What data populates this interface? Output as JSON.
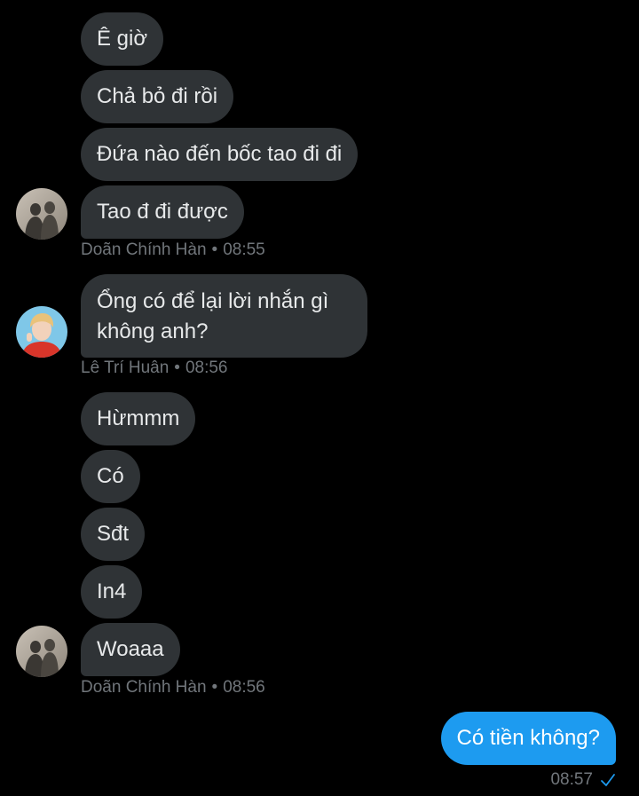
{
  "thread": {
    "group1": {
      "messages": [
        "Ê giờ",
        "Chả bỏ đi rồi",
        "Đứa nào đến bốc tao đi đi",
        "Tao đ đi được"
      ],
      "sender": "Doãn Chính Hàn",
      "time": "08:55"
    },
    "group2": {
      "messages": [
        "Ổng có để lại lời nhắn gì không anh?"
      ],
      "sender": "Lê Trí Huân",
      "time": "08:56"
    },
    "group3": {
      "messages": [
        "Hừmmm",
        "Có",
        "Sđt",
        "In4",
        "Woaaa"
      ],
      "sender": "Doãn Chính Hàn",
      "time": "08:56"
    },
    "outgoing": {
      "message": "Có tiền không?",
      "time": "08:57"
    },
    "separator": "•"
  },
  "icons": {
    "avatar_1": "avatar-couple-silhouette",
    "avatar_2": "avatar-person-red-shirt",
    "read_receipt": "check-icon"
  },
  "colors": {
    "background": "#000000",
    "incoming_bubble": "#2f3336",
    "outgoing_bubble": "#1d9bf0",
    "meta_text": "#71767b",
    "check": "#1d9bf0"
  }
}
